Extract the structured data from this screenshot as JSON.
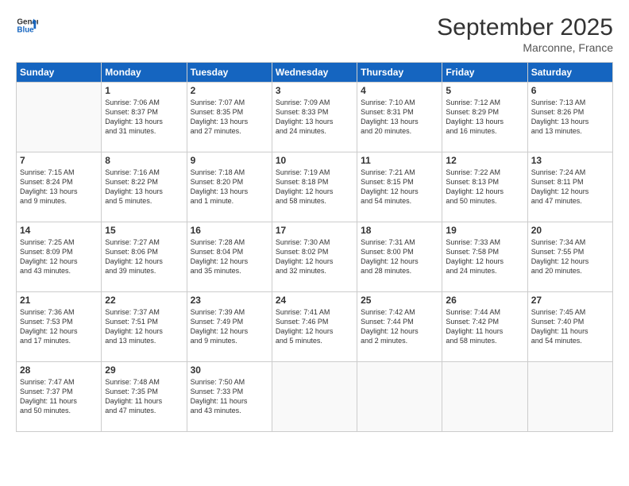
{
  "header": {
    "logo_line1": "General",
    "logo_line2": "Blue",
    "month": "September 2025",
    "location": "Marconne, France"
  },
  "days_of_week": [
    "Sunday",
    "Monday",
    "Tuesday",
    "Wednesday",
    "Thursday",
    "Friday",
    "Saturday"
  ],
  "weeks": [
    [
      {
        "day": "",
        "info": ""
      },
      {
        "day": "1",
        "info": "Sunrise: 7:06 AM\nSunset: 8:37 PM\nDaylight: 13 hours\nand 31 minutes."
      },
      {
        "day": "2",
        "info": "Sunrise: 7:07 AM\nSunset: 8:35 PM\nDaylight: 13 hours\nand 27 minutes."
      },
      {
        "day": "3",
        "info": "Sunrise: 7:09 AM\nSunset: 8:33 PM\nDaylight: 13 hours\nand 24 minutes."
      },
      {
        "day": "4",
        "info": "Sunrise: 7:10 AM\nSunset: 8:31 PM\nDaylight: 13 hours\nand 20 minutes."
      },
      {
        "day": "5",
        "info": "Sunrise: 7:12 AM\nSunset: 8:29 PM\nDaylight: 13 hours\nand 16 minutes."
      },
      {
        "day": "6",
        "info": "Sunrise: 7:13 AM\nSunset: 8:26 PM\nDaylight: 13 hours\nand 13 minutes."
      }
    ],
    [
      {
        "day": "7",
        "info": "Sunrise: 7:15 AM\nSunset: 8:24 PM\nDaylight: 13 hours\nand 9 minutes."
      },
      {
        "day": "8",
        "info": "Sunrise: 7:16 AM\nSunset: 8:22 PM\nDaylight: 13 hours\nand 5 minutes."
      },
      {
        "day": "9",
        "info": "Sunrise: 7:18 AM\nSunset: 8:20 PM\nDaylight: 13 hours\nand 1 minute."
      },
      {
        "day": "10",
        "info": "Sunrise: 7:19 AM\nSunset: 8:18 PM\nDaylight: 12 hours\nand 58 minutes."
      },
      {
        "day": "11",
        "info": "Sunrise: 7:21 AM\nSunset: 8:15 PM\nDaylight: 12 hours\nand 54 minutes."
      },
      {
        "day": "12",
        "info": "Sunrise: 7:22 AM\nSunset: 8:13 PM\nDaylight: 12 hours\nand 50 minutes."
      },
      {
        "day": "13",
        "info": "Sunrise: 7:24 AM\nSunset: 8:11 PM\nDaylight: 12 hours\nand 47 minutes."
      }
    ],
    [
      {
        "day": "14",
        "info": "Sunrise: 7:25 AM\nSunset: 8:09 PM\nDaylight: 12 hours\nand 43 minutes."
      },
      {
        "day": "15",
        "info": "Sunrise: 7:27 AM\nSunset: 8:06 PM\nDaylight: 12 hours\nand 39 minutes."
      },
      {
        "day": "16",
        "info": "Sunrise: 7:28 AM\nSunset: 8:04 PM\nDaylight: 12 hours\nand 35 minutes."
      },
      {
        "day": "17",
        "info": "Sunrise: 7:30 AM\nSunset: 8:02 PM\nDaylight: 12 hours\nand 32 minutes."
      },
      {
        "day": "18",
        "info": "Sunrise: 7:31 AM\nSunset: 8:00 PM\nDaylight: 12 hours\nand 28 minutes."
      },
      {
        "day": "19",
        "info": "Sunrise: 7:33 AM\nSunset: 7:58 PM\nDaylight: 12 hours\nand 24 minutes."
      },
      {
        "day": "20",
        "info": "Sunrise: 7:34 AM\nSunset: 7:55 PM\nDaylight: 12 hours\nand 20 minutes."
      }
    ],
    [
      {
        "day": "21",
        "info": "Sunrise: 7:36 AM\nSunset: 7:53 PM\nDaylight: 12 hours\nand 17 minutes."
      },
      {
        "day": "22",
        "info": "Sunrise: 7:37 AM\nSunset: 7:51 PM\nDaylight: 12 hours\nand 13 minutes."
      },
      {
        "day": "23",
        "info": "Sunrise: 7:39 AM\nSunset: 7:49 PM\nDaylight: 12 hours\nand 9 minutes."
      },
      {
        "day": "24",
        "info": "Sunrise: 7:41 AM\nSunset: 7:46 PM\nDaylight: 12 hours\nand 5 minutes."
      },
      {
        "day": "25",
        "info": "Sunrise: 7:42 AM\nSunset: 7:44 PM\nDaylight: 12 hours\nand 2 minutes."
      },
      {
        "day": "26",
        "info": "Sunrise: 7:44 AM\nSunset: 7:42 PM\nDaylight: 11 hours\nand 58 minutes."
      },
      {
        "day": "27",
        "info": "Sunrise: 7:45 AM\nSunset: 7:40 PM\nDaylight: 11 hours\nand 54 minutes."
      }
    ],
    [
      {
        "day": "28",
        "info": "Sunrise: 7:47 AM\nSunset: 7:37 PM\nDaylight: 11 hours\nand 50 minutes."
      },
      {
        "day": "29",
        "info": "Sunrise: 7:48 AM\nSunset: 7:35 PM\nDaylight: 11 hours\nand 47 minutes."
      },
      {
        "day": "30",
        "info": "Sunrise: 7:50 AM\nSunset: 7:33 PM\nDaylight: 11 hours\nand 43 minutes."
      },
      {
        "day": "",
        "info": ""
      },
      {
        "day": "",
        "info": ""
      },
      {
        "day": "",
        "info": ""
      },
      {
        "day": "",
        "info": ""
      }
    ]
  ]
}
